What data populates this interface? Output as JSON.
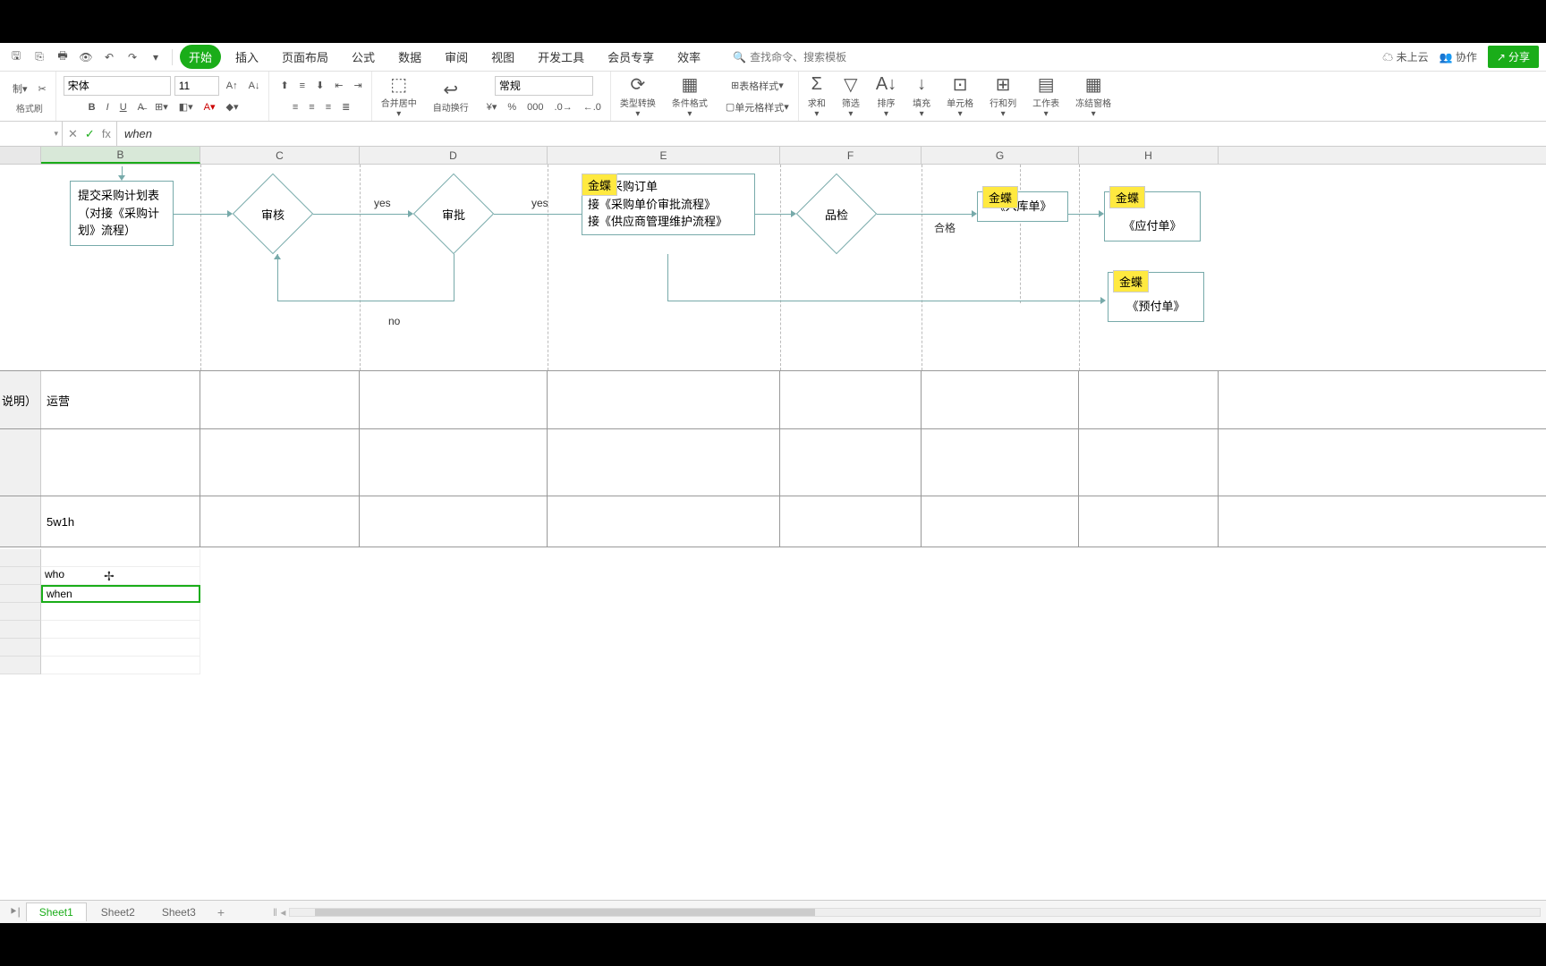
{
  "tabs": {
    "start": "开始",
    "insert": "插入",
    "layout": "页面布局",
    "formula": "公式",
    "data": "数据",
    "review": "审阅",
    "view": "视图",
    "dev": "开发工具",
    "member": "会员专享",
    "efficiency": "效率"
  },
  "search_placeholder": "查找命令、搜索模板",
  "cloud_status": "未上云",
  "collab": "协作",
  "share": "分享",
  "format_painter": "格式刷",
  "font": "宋体",
  "font_size": "11",
  "merge_center": "合并居中",
  "wrap_text": "自动换行",
  "number_format": "常规",
  "type_convert": "类型转换",
  "cond_format": "条件格式",
  "table_style": "表格样式",
  "cell_style": "单元格样式",
  "sum": "求和",
  "filter": "筛选",
  "sort": "排序",
  "fill": "填充",
  "cell": "单元格",
  "rowcol": "行和列",
  "worksheet": "工作表",
  "freeze": "冻结窗格",
  "formula_bar": {
    "fx": "fx",
    "value": "when"
  },
  "columns": [
    "B",
    "C",
    "D",
    "E",
    "F",
    "G",
    "H"
  ],
  "row_label_a": "说明）",
  "flowchart": {
    "box1": "提交采购计划表（对接《采购计划》流程）",
    "diamond1": "审核",
    "diamond2": "审批",
    "yes1": "yes",
    "yes2": "yes",
    "no": "no",
    "tag": "金蝶",
    "box_e_l1": "下达采购订单",
    "box_e_l2": "接《采购单价审批流程》",
    "box_e_l3": "接《供应商管理维护流程》",
    "diamond3": "品检",
    "pass": "合格",
    "box_g": "《入库单》",
    "box_h1": "《应付单》",
    "box_h2": "《预付单》"
  },
  "cells": {
    "b_ops": "运营",
    "b_5w1h": "5w1h",
    "b_who": "who",
    "b_when": "when"
  },
  "sheets": [
    "Sheet1",
    "Sheet2",
    "Sheet3"
  ],
  "active_sheet": "Sheet1"
}
